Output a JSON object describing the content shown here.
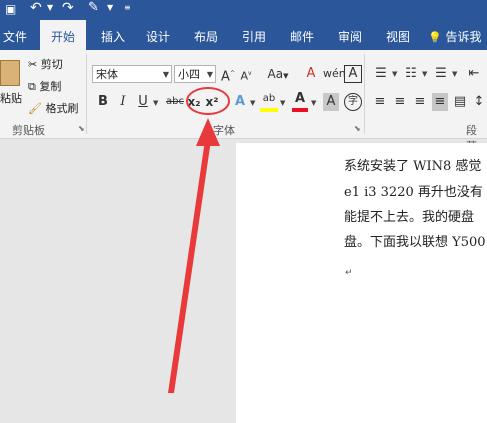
{
  "quick_access": {
    "save_icon": "save-icon",
    "undo_icon": "undo-icon",
    "redo_icon": "redo-icon",
    "paint_icon": "format-painter-icon"
  },
  "tabs": [
    {
      "label": "文件"
    },
    {
      "label": "开始"
    },
    {
      "label": "插入"
    },
    {
      "label": "设计"
    },
    {
      "label": "布局"
    },
    {
      "label": "引用"
    },
    {
      "label": "邮件"
    },
    {
      "label": "审阅"
    },
    {
      "label": "视图"
    },
    {
      "label": "告诉我"
    }
  ],
  "clipboard": {
    "paste": "粘贴",
    "cut": "剪切",
    "copy": "复制",
    "painter": "格式刷",
    "group": "剪贴板"
  },
  "font": {
    "name": "宋体",
    "size": "小四",
    "group": "字体",
    "subscript": "x₂",
    "superscript": "x²",
    "grow": "A",
    "shrink": "A",
    "case": "Aa",
    "clear": "A",
    "char_border": "A",
    "strike": "abc",
    "bold": "B",
    "italic": "I",
    "underline": "U",
    "text_effect": "A",
    "highlight": "ab",
    "color": "A",
    "char_shade": "A",
    "phonetic": "字"
  },
  "paragraph": {
    "group": "段落"
  },
  "document": {
    "lines": [
      "系统安装了 WIN8 感觉",
      "e1  i3  3220 再升也没有",
      "能提不上去。我的硬盘",
      "盘。下面我以联想 Y500"
    ],
    "mark": "↵"
  },
  "colors": {
    "accent": "#2b579a",
    "arrow": "#e8393b",
    "highlight": "#ffff00",
    "font_color": "#e81123"
  }
}
